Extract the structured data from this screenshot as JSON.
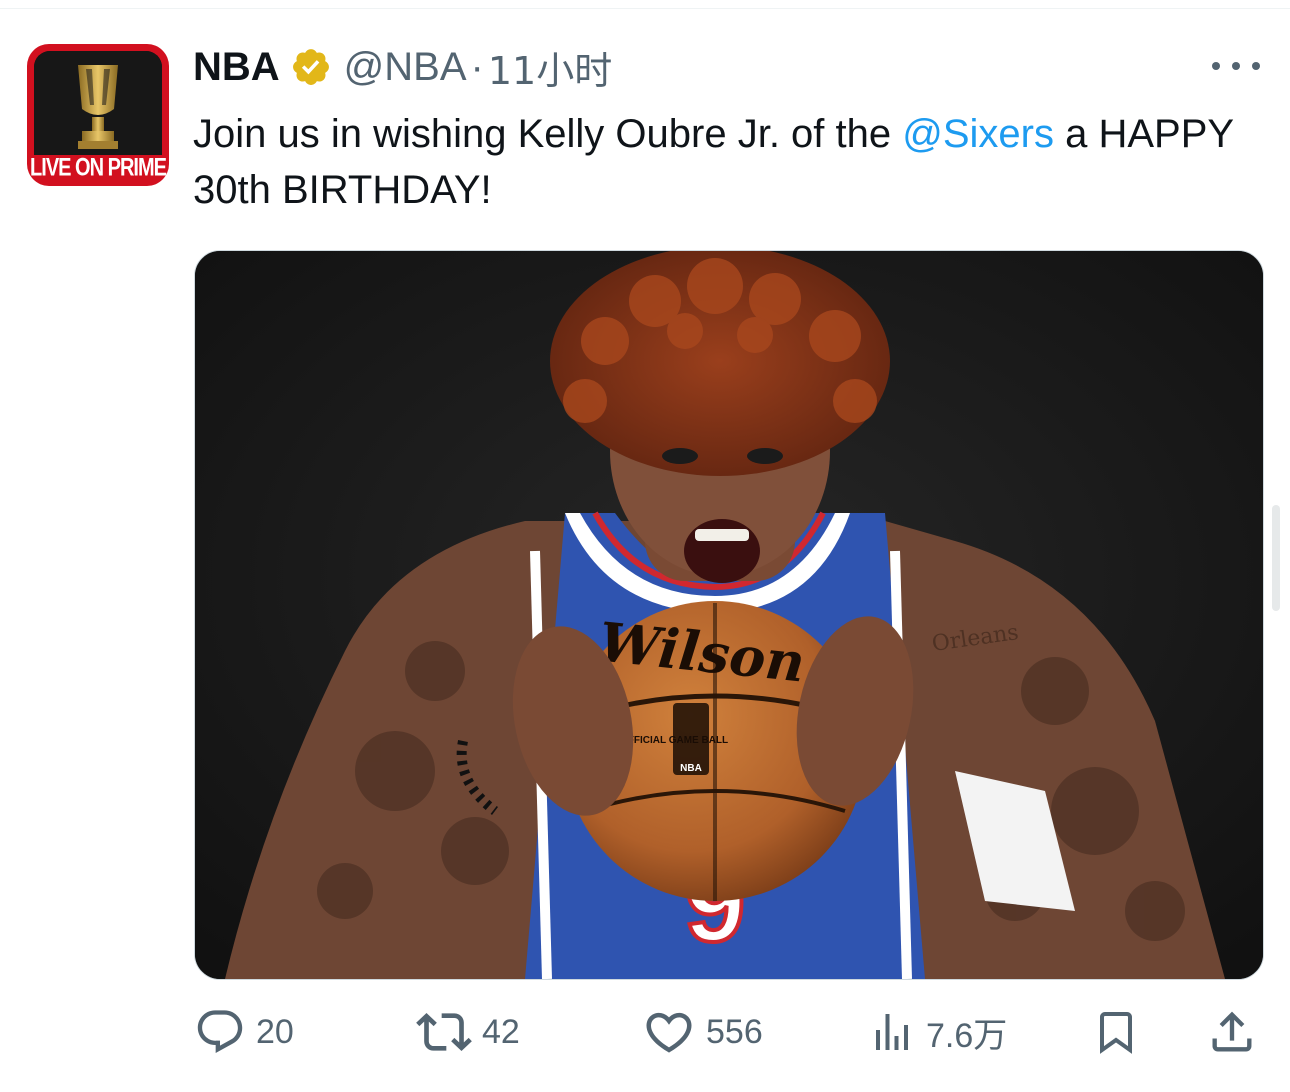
{
  "tweet": {
    "author_name": "NBA",
    "handle": "@NBA",
    "separator": "·",
    "time": "11小时",
    "text_before": "Join us in wishing Kelly Oubre Jr. of the ",
    "mention": "@Sixers",
    "text_after": " a HAPPY 30th BIRTHDAY!"
  },
  "avatar": {
    "band_text": "LIVE ON PRIME",
    "brand_color": "#d2101f",
    "trophy_color": "#c8a34a"
  },
  "media": {
    "ball_brand": "Wilson",
    "ball_text_left": "OFFICIAL GAME BALL",
    "ball_logo": "NBA",
    "jersey_number": "9",
    "tattoo_text": "Orleans"
  },
  "actions": {
    "reply_count": "20",
    "retweet_count": "42",
    "like_count": "556",
    "views_count": "7.6万"
  },
  "icons": [
    "verified-badge-icon",
    "more-icon",
    "reply-icon",
    "retweet-icon",
    "like-icon",
    "views-icon",
    "bookmark-icon",
    "share-icon"
  ],
  "colors": {
    "link": "#1d9bf0",
    "muted": "#536471",
    "text": "#0f1419",
    "verified_gold": "#e2b719"
  }
}
